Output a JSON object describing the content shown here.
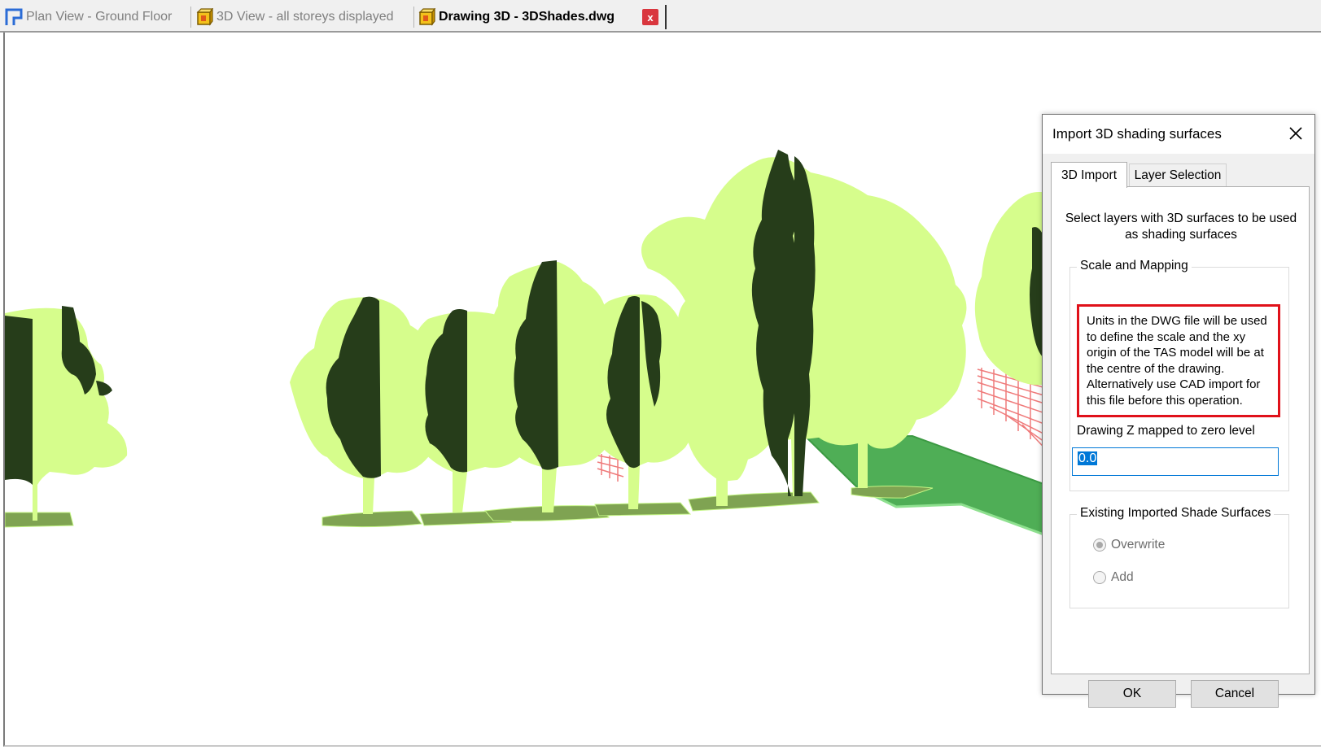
{
  "tabs": [
    {
      "label": "Plan View - Ground Floor",
      "icon": "plan-view-icon",
      "active": false
    },
    {
      "label": "3D View - all storeys displayed",
      "icon": "3d-box-icon",
      "active": false
    },
    {
      "label": "Drawing 3D - 3DShades.dwg",
      "icon": "3d-box-icon",
      "active": true
    }
  ],
  "tab_close_glyph": "x",
  "dialog": {
    "title": "Import 3D shading surfaces",
    "tabs": [
      "3D Import",
      "Layer Selection"
    ],
    "intro": "Select layers with 3D surfaces to be used as shading surfaces",
    "scale_group": "Scale and Mapping",
    "warning": "Units in the DWG file will be used to define the scale and the xy origin of the TAS model will be at the centre of the drawing. Alternatively use CAD import for this file before this operation.",
    "z_label": "Drawing Z mapped to zero level",
    "z_value": "0.0",
    "existing_group": "Existing Imported Shade Surfaces",
    "overwrite": "Overwrite",
    "add": "Add",
    "selected_option": "Overwrite",
    "ok": "OK",
    "cancel": "Cancel"
  },
  "colors": {
    "canopy_light": "#d6fd8c",
    "canopy_dark": "#263d1a",
    "ground_shadow": "#7fa352",
    "platform": "#4fae56",
    "railing": "#ef7a7a",
    "warning_border": "#e0111a"
  }
}
